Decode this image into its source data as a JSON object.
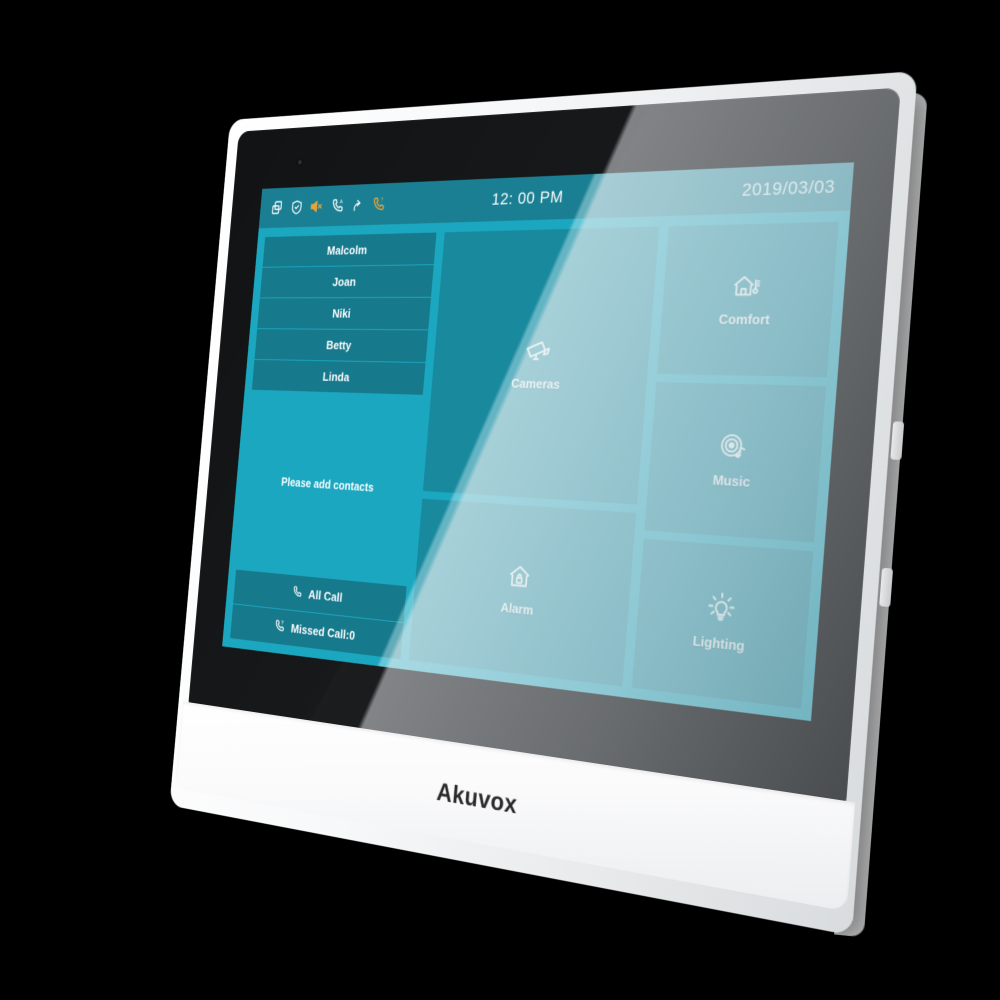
{
  "device": {
    "brand_logo": "Akuvox",
    "type": "indoor-monitor-touchscreen"
  },
  "statusbar": {
    "time": "12: 00 PM",
    "date": "2019/03/03",
    "icons": [
      {
        "name": "multi-window-icon",
        "color": "#ffffff"
      },
      {
        "name": "shield-check-icon",
        "color": "#ffffff"
      },
      {
        "name": "speaker-mute-icon",
        "color": "#e8a43a"
      },
      {
        "name": "phone-auto-answer-icon",
        "color": "#ffffff"
      },
      {
        "name": "call-forward-icon",
        "color": "#ffffff"
      },
      {
        "name": "phone-missed-call-icon",
        "color": "#e8a43a"
      }
    ]
  },
  "contacts": {
    "items": [
      {
        "name": "Malcolm"
      },
      {
        "name": "Joan"
      },
      {
        "name": "Niki"
      },
      {
        "name": "Betty"
      },
      {
        "name": "Linda"
      }
    ],
    "empty_hint": "Please add contacts"
  },
  "call_actions": [
    {
      "label": "All Call",
      "icon": "phone-icon"
    },
    {
      "label": "Missed Call:0",
      "icon": "phone-missed-icon"
    }
  ],
  "tiles": [
    {
      "label": "Cameras",
      "icon": "cctv-camera-icon"
    },
    {
      "label": "Alarm",
      "icon": "house-lock-icon"
    },
    {
      "label": "Comfort",
      "icon": "house-thermometer-icon"
    },
    {
      "label": "Music",
      "icon": "vinyl-record-note-icon"
    },
    {
      "label": "Lighting",
      "icon": "light-bulb-icon"
    }
  ],
  "colors": {
    "screen_bg": "#1ba7bf",
    "statusbar_bg": "#1a7f93",
    "tile_bg": "#19899e",
    "list_bg": "#16798c",
    "accent_orange": "#e8a43a",
    "page_bg": "#000000",
    "chin": "#ffffff"
  }
}
